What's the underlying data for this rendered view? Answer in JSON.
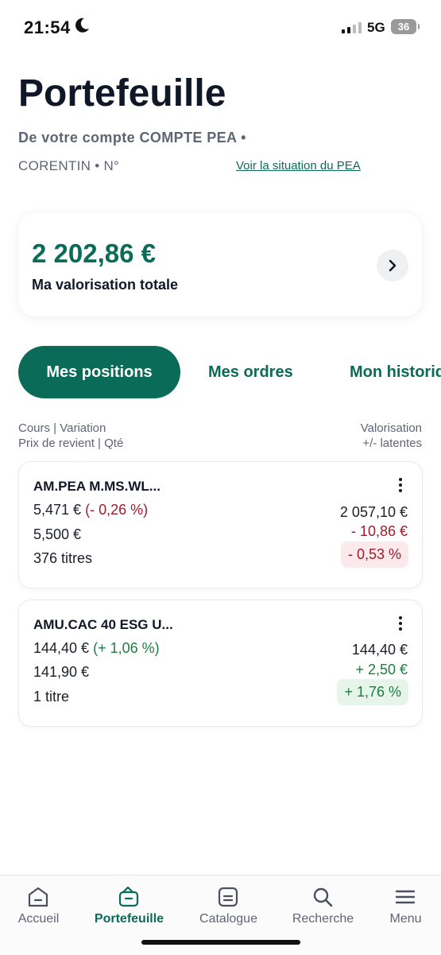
{
  "status": {
    "time": "21:54",
    "network": "5G",
    "battery": "36"
  },
  "header": {
    "title": "Portefeuille",
    "subtitle": "De votre compte COMPTE PEA •",
    "subtitle2": "CORENTIN • N°",
    "link": "Voir la situation du PEA"
  },
  "summary": {
    "value": "2 202,86 €",
    "label": "Ma valorisation totale"
  },
  "tabs": [
    "Mes positions",
    "Mes ordres",
    "Mon historique"
  ],
  "columns": {
    "left1": "Cours | Variation",
    "left2": "Prix de revient | Qté",
    "right1": "Valorisation",
    "right2": "+/- latentes"
  },
  "positions": [
    {
      "name": "AM.PEA M.MS.WL...",
      "price": "5,471 €",
      "variation": "(- 0,26 %)",
      "cost": "5,500 €",
      "qty": "376 titres",
      "valuation": "2 057,10 €",
      "latent": "- 10,86 €",
      "latent_pct": "- 0,53 %"
    },
    {
      "name": "AMU.CAC 40 ESG U...",
      "price": "144,40 €",
      "variation": "(+ 1,06 %)",
      "cost": "141,90 €",
      "qty": "1 titre",
      "valuation": "144,40 €",
      "latent": "+ 2,50 €",
      "latent_pct": "+ 1,76 %"
    }
  ],
  "tabbar": [
    {
      "label": "Accueil",
      "icon": "home-icon"
    },
    {
      "label": "Portefeuille",
      "icon": "wallet-icon"
    },
    {
      "label": "Catalogue",
      "icon": "catalog-icon"
    },
    {
      "label": "Recherche",
      "icon": "search-icon"
    },
    {
      "label": "Menu",
      "icon": "menu-icon"
    }
  ],
  "colors": {
    "brand_green": "#0b6b59",
    "negative": "#a11b2b",
    "positive": "#1e7d46"
  }
}
